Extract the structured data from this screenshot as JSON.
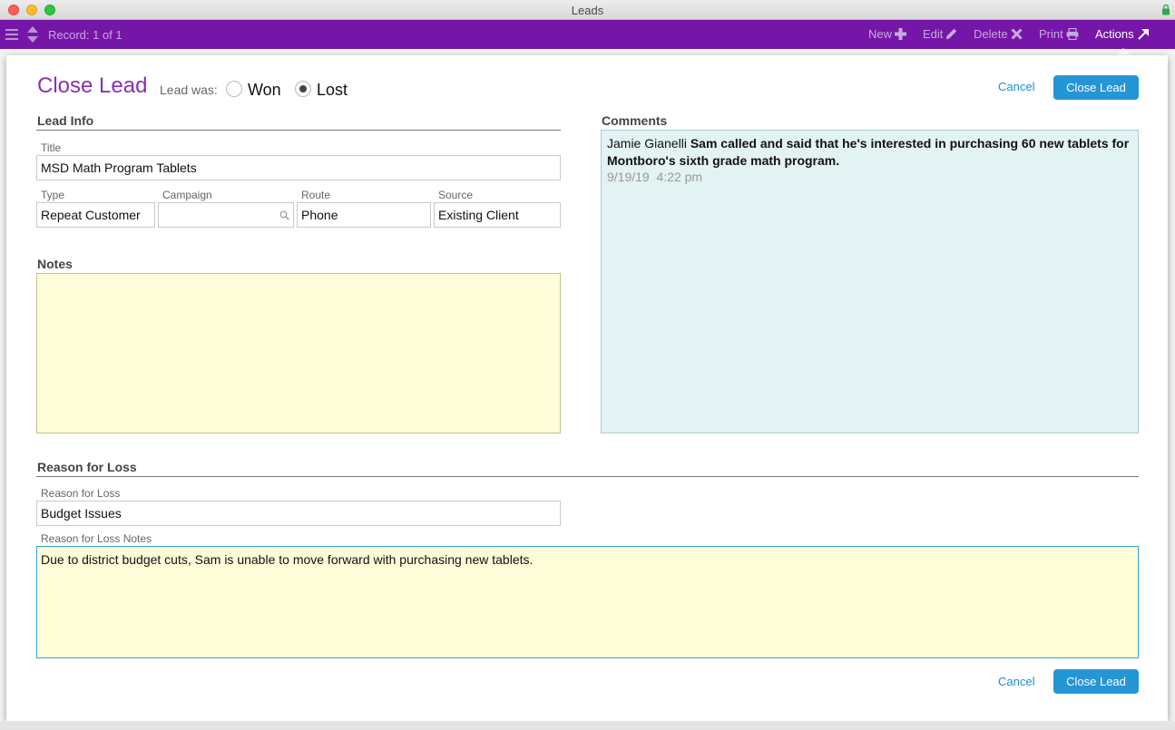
{
  "window": {
    "title": "Leads"
  },
  "toolbar": {
    "record_label": "Record: 1 of 1",
    "new_label": "New",
    "edit_label": "Edit",
    "delete_label": "Delete",
    "print_label": "Print",
    "actions_label": "Actions",
    "color": "#7516a8"
  },
  "sheet": {
    "title": "Close Lead",
    "lead_was_label": "Lead was:",
    "options": [
      {
        "label": "Won",
        "checked": false
      },
      {
        "label": "Lost",
        "checked": true
      }
    ],
    "cancel_label": "Cancel",
    "close_lead_label": "Close Lead"
  },
  "lead_info": {
    "heading": "Lead Info",
    "title_label": "Title",
    "title_value": "MSD Math Program Tablets",
    "type_label": "Type",
    "type_value": "Repeat Customer",
    "campaign_label": "Campaign",
    "campaign_value": "",
    "route_label": "Route",
    "route_value": "Phone",
    "source_label": "Source",
    "source_value": "Existing Client"
  },
  "notes": {
    "heading": "Notes",
    "value": ""
  },
  "comments": {
    "heading": "Comments",
    "items": [
      {
        "author": "Jamie Gianelli",
        "text": "Sam called and said that he's interested in purchasing 60 new tablets for Montboro's sixth grade math program.",
        "date": "9/19/19",
        "time": "4:22 pm"
      }
    ]
  },
  "reason_for_loss": {
    "heading": "Reason for Loss",
    "reason_label": "Reason for Loss",
    "reason_value": "Budget Issues",
    "notes_label": "Reason for Loss Notes",
    "notes_value": "Due to district budget cuts, Sam is unable to move forward with purchasing new tablets."
  },
  "footer": {
    "cancel_label": "Cancel",
    "close_lead_label": "Close Lead"
  },
  "colors": {
    "accent": "#8c2fb4",
    "button": "#2496d6",
    "notes_bg": "#fffcd8",
    "comments_bg": "#e3f2f3"
  }
}
